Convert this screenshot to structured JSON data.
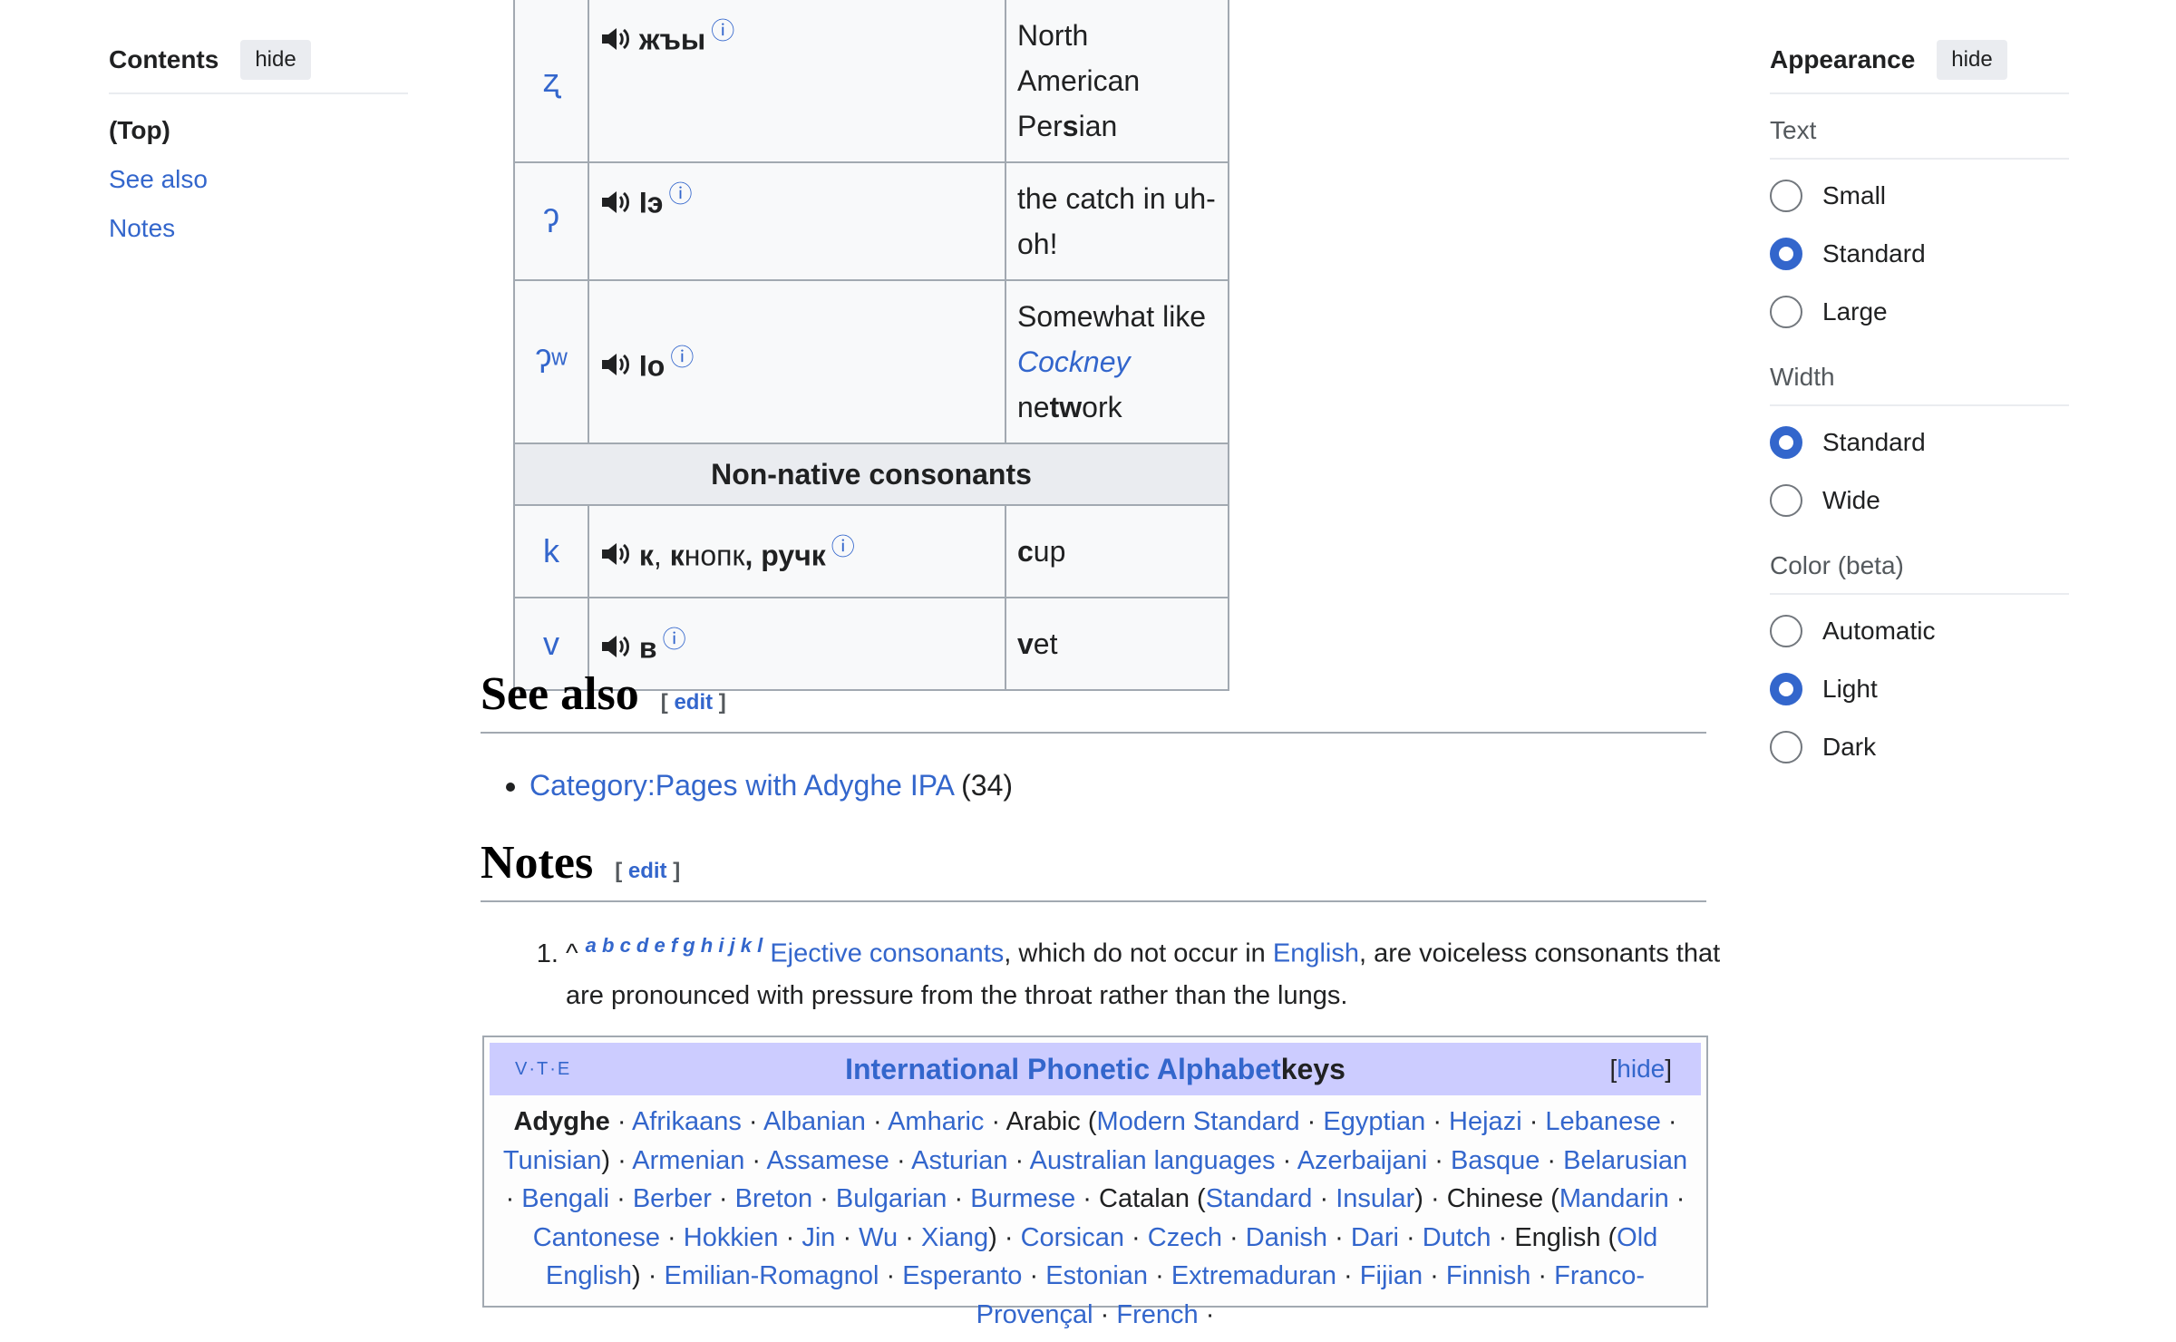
{
  "toc": {
    "title": "Contents",
    "hide": "hide",
    "items": [
      "(Top)",
      "See also",
      "Notes"
    ]
  },
  "appearance": {
    "title": "Appearance",
    "hide": "hide",
    "text_label": "Text",
    "text_options": [
      "Small",
      "Standard",
      "Large"
    ],
    "width_label": "Width",
    "width_options": [
      "Standard",
      "Wide"
    ],
    "color_label": "Color (beta)",
    "color_options": [
      "Automatic",
      "Light",
      "Dark"
    ],
    "accent": "#3366cc"
  },
  "table": {
    "rows": [
      {
        "ipa": "ʐ",
        "example": "жъы",
        "english": "North American Persian"
      },
      {
        "ipa": "ʔ",
        "example": "Iэ",
        "english": "the catch in uh-oh!"
      },
      {
        "ipa": "ʔʷ",
        "example": "Iо",
        "english": "Somewhat like Cockney network"
      }
    ],
    "section": "Non-native consonants",
    "rows2": [
      {
        "ipa": "k",
        "example": "к, кнопк, ручк",
        "english": "cup"
      },
      {
        "ipa": "v",
        "example": "в",
        "english": "vet"
      }
    ],
    "english_parts": {
      "r1a": "North",
      "r1b": "American",
      "r1c": "Per",
      "r1d": "s",
      "r1e": "ian",
      "r2a": "the catch in uh-",
      "r2b": "oh!",
      "r3a": "Somewhat like",
      "r3b": "Cockney",
      "r3c": "ne",
      "r3d": "tw",
      "r3e": "ork",
      "r4a": "c",
      "r4b": "up",
      "r5a": "v",
      "r5b": "et"
    },
    "example_parts": {
      "r4a": "к",
      "r4b": ", ",
      "r4c": "к",
      "r4d": "нопк",
      "r4e": ", ручк"
    },
    "info_icon": "ⓘ"
  },
  "see_also": {
    "heading": "See also",
    "edit": "edit",
    "item_link": "Category:Pages with Adyghe IPA",
    "item_count": "(34)"
  },
  "notes": {
    "heading": "Notes",
    "edit": "edit",
    "caret": "^",
    "letters": "a b c d e f g h i j k l",
    "link1": "Ejective consonants",
    "text1": ", which do not occur in ",
    "link2": "English",
    "text2": ", are voiceless consonants that are pronounced with pressure from the throat rather than the lungs."
  },
  "navbox": {
    "vte": "V·T·E",
    "title_link": "International Phonetic Alphabet",
    "title_rest": " keys",
    "hide": "hide",
    "line1": [
      "Adyghe",
      "Afrikaans",
      "Albanian",
      "Amharic"
    ],
    "arabic_label": "Arabic",
    "arabic_items": [
      "Modern Standard",
      "Egyptian",
      "Hejazi",
      "Lebanese",
      "Tunisian"
    ],
    "line2": [
      "Armenian",
      "Assamese",
      "Asturian",
      "Australian languages",
      "Azerbaijani",
      "Basque",
      "Belarusian"
    ],
    "line3": [
      "Bengali",
      "Berber",
      "Breton",
      "Bulgarian",
      "Burmese"
    ],
    "catalan_label": "Catalan",
    "catalan_items": [
      "Standard",
      "Insular"
    ],
    "chinese_label": "Chinese",
    "chinese_items": [
      "Mandarin",
      "Cantonese",
      "Hokkien",
      "Jin",
      "Wu",
      "Xiang"
    ],
    "line4": [
      "Corsican",
      "Czech",
      "Danish",
      "Dari",
      "Dutch"
    ],
    "english_label": "English",
    "english_items": [
      "Old English"
    ],
    "line5": [
      "Emilian-Romagnol",
      "Esperanto",
      "Estonian",
      "Extremaduran",
      "Fijian",
      "Finnish",
      "Franco-Provençal",
      "French"
    ]
  }
}
